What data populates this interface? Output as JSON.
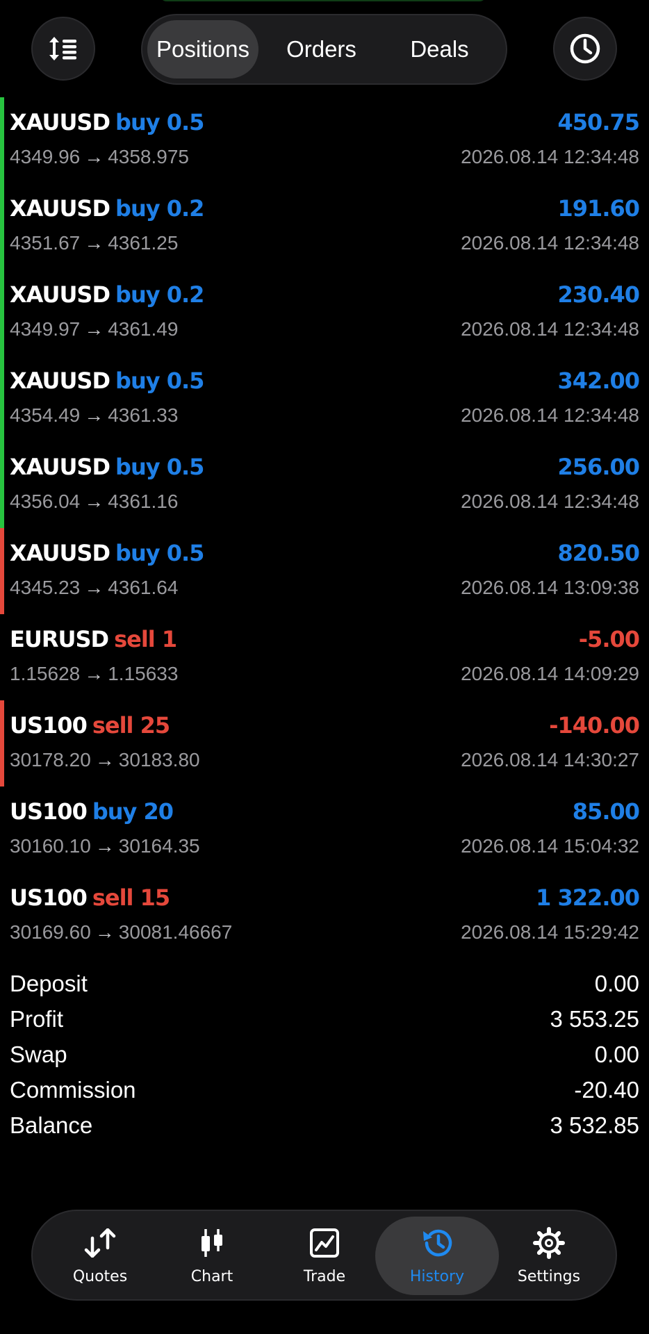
{
  "header": {
    "tabs": [
      {
        "label": "Positions",
        "active": true
      },
      {
        "label": "Orders",
        "active": false
      },
      {
        "label": "Deals",
        "active": false
      }
    ],
    "left_icon": "sort-icon",
    "right_icon": "clock-icon"
  },
  "colors": {
    "buy": "#1f7fe6",
    "sell": "#e5483b",
    "marker_green": "#27c33f",
    "marker_red": "#e5483b",
    "muted_text": "#9a9a9e",
    "active_nav": "#1f8af0"
  },
  "trades": [
    {
      "symbol": "XAUUSD",
      "side": "buy 0.5",
      "profit": "450.75",
      "open": "4349.96",
      "close": "4358.975",
      "time": "2026.08.14 12:34:48",
      "marker": "green"
    },
    {
      "symbol": "XAUUSD",
      "side": "buy 0.2",
      "profit": "191.60",
      "open": "4351.67",
      "close": "4361.25",
      "time": "2026.08.14 12:34:48",
      "marker": "green"
    },
    {
      "symbol": "XAUUSD",
      "side": "buy 0.2",
      "profit": "230.40",
      "open": "4349.97",
      "close": "4361.49",
      "time": "2026.08.14 12:34:48",
      "marker": "green"
    },
    {
      "symbol": "XAUUSD",
      "side": "buy 0.5",
      "profit": "342.00",
      "open": "4354.49",
      "close": "4361.33",
      "time": "2026.08.14 12:34:48",
      "marker": "green"
    },
    {
      "symbol": "XAUUSD",
      "side": "buy 0.5",
      "profit": "256.00",
      "open": "4356.04",
      "close": "4361.16",
      "time": "2026.08.14 12:34:48",
      "marker": "green"
    },
    {
      "symbol": "XAUUSD",
      "side": "buy 0.5",
      "profit": "820.50",
      "open": "4345.23",
      "close": "4361.64",
      "time": "2026.08.14 13:09:38",
      "marker": "red"
    },
    {
      "symbol": "EURUSD",
      "side": "sell 1",
      "profit": "-5.00",
      "open": "1.15628",
      "close": "1.15633",
      "time": "2026.08.14 14:09:29",
      "marker": "none"
    },
    {
      "symbol": "US100",
      "side": "sell 25",
      "profit": "-140.00",
      "open": "30178.20",
      "close": "30183.80",
      "time": "2026.08.14 14:30:27",
      "marker": "red"
    },
    {
      "symbol": "US100",
      "side": "buy 20",
      "profit": "85.00",
      "open": "30160.10",
      "close": "30164.35",
      "time": "2026.08.14 15:04:32",
      "marker": "none"
    },
    {
      "symbol": "US100",
      "side": "sell 15",
      "profit": "1 322.00",
      "open": "30169.60",
      "close": "30081.46667",
      "time": "2026.08.14 15:29:42",
      "marker": "none"
    }
  ],
  "arrow": "→",
  "summary": [
    {
      "label": "Deposit",
      "value": "0.00"
    },
    {
      "label": "Profit",
      "value": "3 553.25"
    },
    {
      "label": "Swap",
      "value": "0.00"
    },
    {
      "label": "Commission",
      "value": "-20.40"
    },
    {
      "label": "Balance",
      "value": "3 532.85"
    }
  ],
  "nav": [
    {
      "label": "Quotes",
      "icon": "quotes-icon",
      "active": false
    },
    {
      "label": "Chart",
      "icon": "candlestick-icon",
      "active": false
    },
    {
      "label": "Trade",
      "icon": "trade-chart-icon",
      "active": false
    },
    {
      "label": "History",
      "icon": "history-icon",
      "active": true
    },
    {
      "label": "Settings",
      "icon": "gear-icon",
      "active": false
    }
  ]
}
